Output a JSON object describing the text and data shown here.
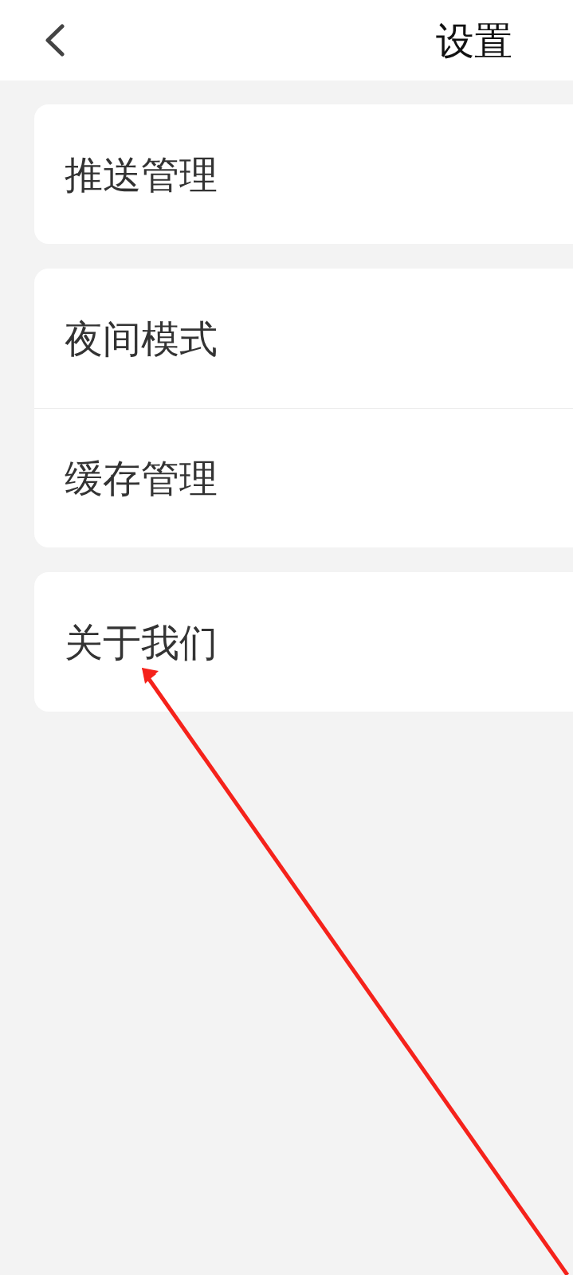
{
  "header": {
    "title": "设置"
  },
  "groups": [
    {
      "items": [
        {
          "label": "推送管理"
        }
      ]
    },
    {
      "items": [
        {
          "label": "夜间模式"
        },
        {
          "label": "缓存管理"
        }
      ]
    },
    {
      "items": [
        {
          "label": "关于我们"
        }
      ]
    }
  ]
}
